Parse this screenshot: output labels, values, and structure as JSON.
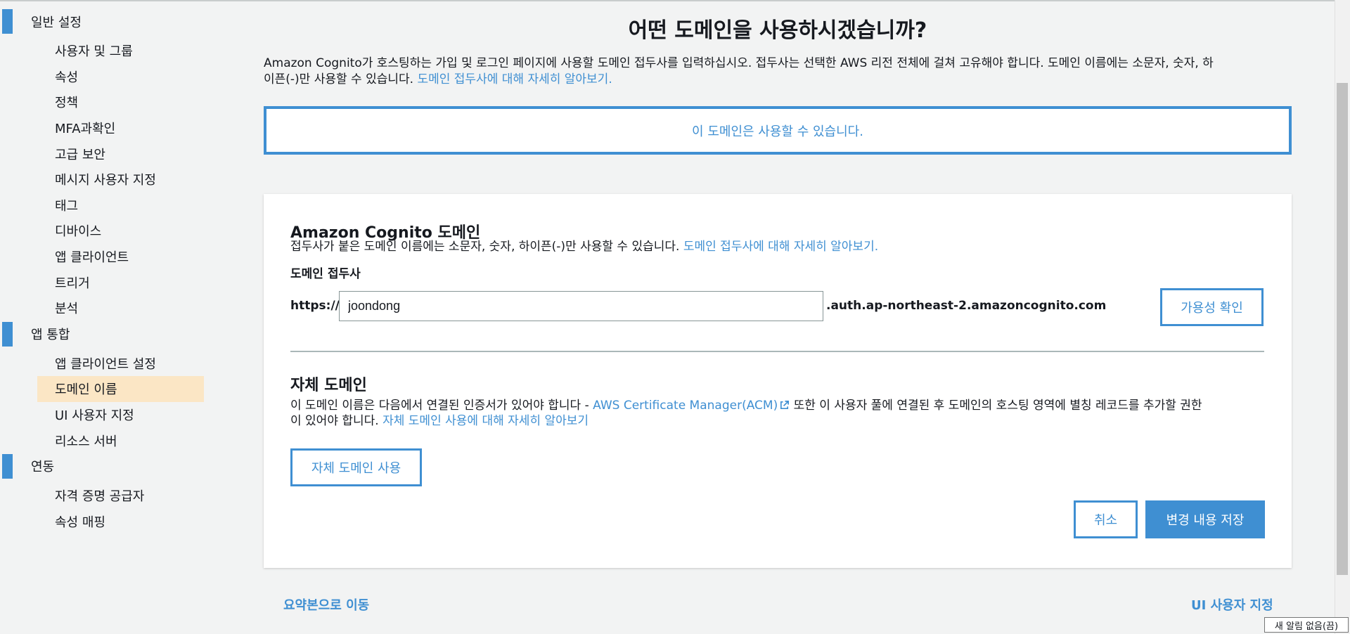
{
  "sidebar": {
    "sections": [
      {
        "label": "일반 설정",
        "items": [
          "사용자 및 그룹",
          "속성",
          "정책",
          "MFA과확인",
          "고급 보안",
          "메시지 사용자 지정",
          "태그",
          "디바이스",
          "앱 클라이언트",
          "트리거",
          "분석"
        ]
      },
      {
        "label": "앱 통합",
        "items": [
          "앱 클라이언트 설정",
          "도메인 이름",
          "UI 사용자 지정",
          "리소스 서버"
        ]
      },
      {
        "label": "연동",
        "items": [
          "자격 증명 공급자",
          "속성 매핑"
        ]
      }
    ],
    "active_item": "도메인 이름"
  },
  "page": {
    "title": "어떤 도메인을 사용하시겠습니까?",
    "intro_line1": "Amazon Cognito가 호스팅하는 가입 및 로그인 페이지에 사용할 도메인 접두사를 입력하십시오. 접두사는 선택한 AWS 리전 전체에 걸쳐 고유해야 합니다. 도메인 이름에는 소문자, 숫자, 하",
    "intro_line2": "이픈(-)만 사용할 수 있습니다. ",
    "intro_link": "도메인 접두사에 대해 자세히 알아보기.",
    "availability_alert": "이 도메인은 사용할 수 있습니다."
  },
  "cognito_domain": {
    "title": "Amazon Cognito 도메인",
    "description": "접두사가 붙은 도메인 이름에는 소문자, 숫자, 하이픈(-)만 사용할 수 있습니다. ",
    "description_link": "도메인 접두사에 대해 자세히 알아보기.",
    "field_label": "도메인 접두사",
    "prefix": "https://",
    "input_value": "joondong",
    "suffix": ".auth.ap-northeast-2.amazoncognito.com",
    "check_button": "가용성 확인"
  },
  "custom_domain": {
    "title": "자체 도메인",
    "desc_part1": "이 도메인 이름은 다음에서 연결된 인증서가 있어야 합니다 - ",
    "acm_link": "AWS Certificate Manager(ACM)",
    "desc_part2": " 또한 이 사용자 풀에 연결된 후 도메인의 호스팅 영역에 별칭 레코드를 추가할 권한",
    "desc_part3": "이 있어야 합니다. ",
    "desc_link": "자체 도메인 사용에 대해 자세히 알아보기",
    "use_button": "자체 도메인 사용"
  },
  "actions": {
    "cancel": "취소",
    "save": "변경 내용 저장"
  },
  "footer": {
    "prev_link": "요약본으로 이동",
    "next_link": "UI 사용자 지정"
  },
  "status_tip": "새 알림 없음(끔)",
  "colors": {
    "accent": "#3f8fd2",
    "active_bg": "#fbe6c5",
    "page_bg": "#f2f3f3"
  }
}
